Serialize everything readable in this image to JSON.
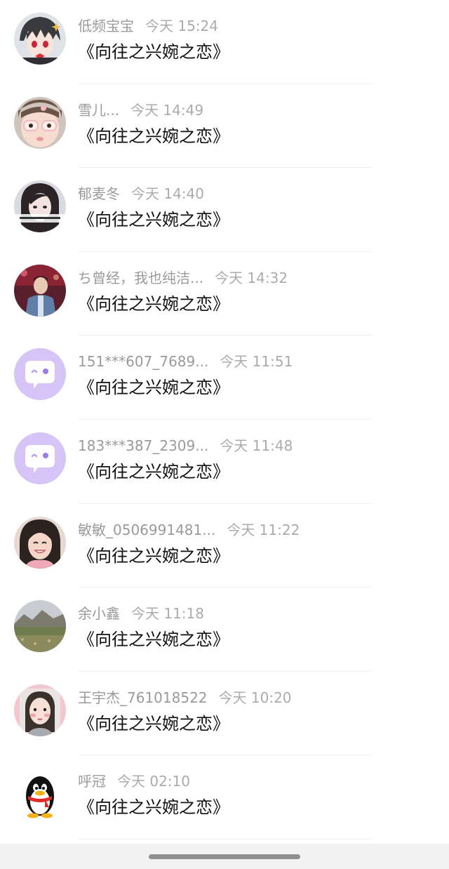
{
  "items": [
    {
      "name": "低频宝宝",
      "time": "今天 15:24",
      "text": "《向往之兴婉之恋》",
      "avatar": "anime-boy-avatar"
    },
    {
      "name": "雪儿...",
      "time": "今天 14:49",
      "text": "《向往之兴婉之恋》",
      "avatar": "child-with-glasses-avatar"
    },
    {
      "name": "郁麦冬",
      "time": "今天 14:40",
      "text": "《向往之兴婉之恋》",
      "avatar": "girl-selfie-avatar"
    },
    {
      "name": "ち曾经，我也纯洁...",
      "time": "今天 14:32",
      "text": "《向往之兴婉之恋》",
      "avatar": "man-on-stage-avatar"
    },
    {
      "name": "151***607_7689...",
      "time": "今天 11:51",
      "text": "《向往之兴婉之恋》",
      "avatar": "default-chat-bubble-avatar"
    },
    {
      "name": "183***387_2309...",
      "time": "今天 11:48",
      "text": "《向往之兴婉之恋》",
      "avatar": "default-chat-bubble-avatar"
    },
    {
      "name": "敏敏_0506991481...",
      "time": "今天 11:22",
      "text": "《向往之兴婉之恋》",
      "avatar": "smiling-girl-avatar"
    },
    {
      "name": "余小鑫",
      "time": "今天 11:18",
      "text": "《向往之兴婉之恋》",
      "avatar": "landscape-avatar"
    },
    {
      "name": "王宇杰_761018522",
      "time": "今天 10:20",
      "text": "《向往之兴婉之恋》",
      "avatar": "girl-pink-frame-avatar"
    },
    {
      "name": "呼冠",
      "time": "今天 02:10",
      "text": "《向往之兴婉之恋》",
      "avatar": "penguin-avatar"
    }
  ],
  "colors": {
    "name_text": "#9a9a9a",
    "time_text": "#ababab",
    "message_text": "#111111",
    "default_avatar_bg": "#d6c4f7",
    "divider": "#efefef"
  }
}
